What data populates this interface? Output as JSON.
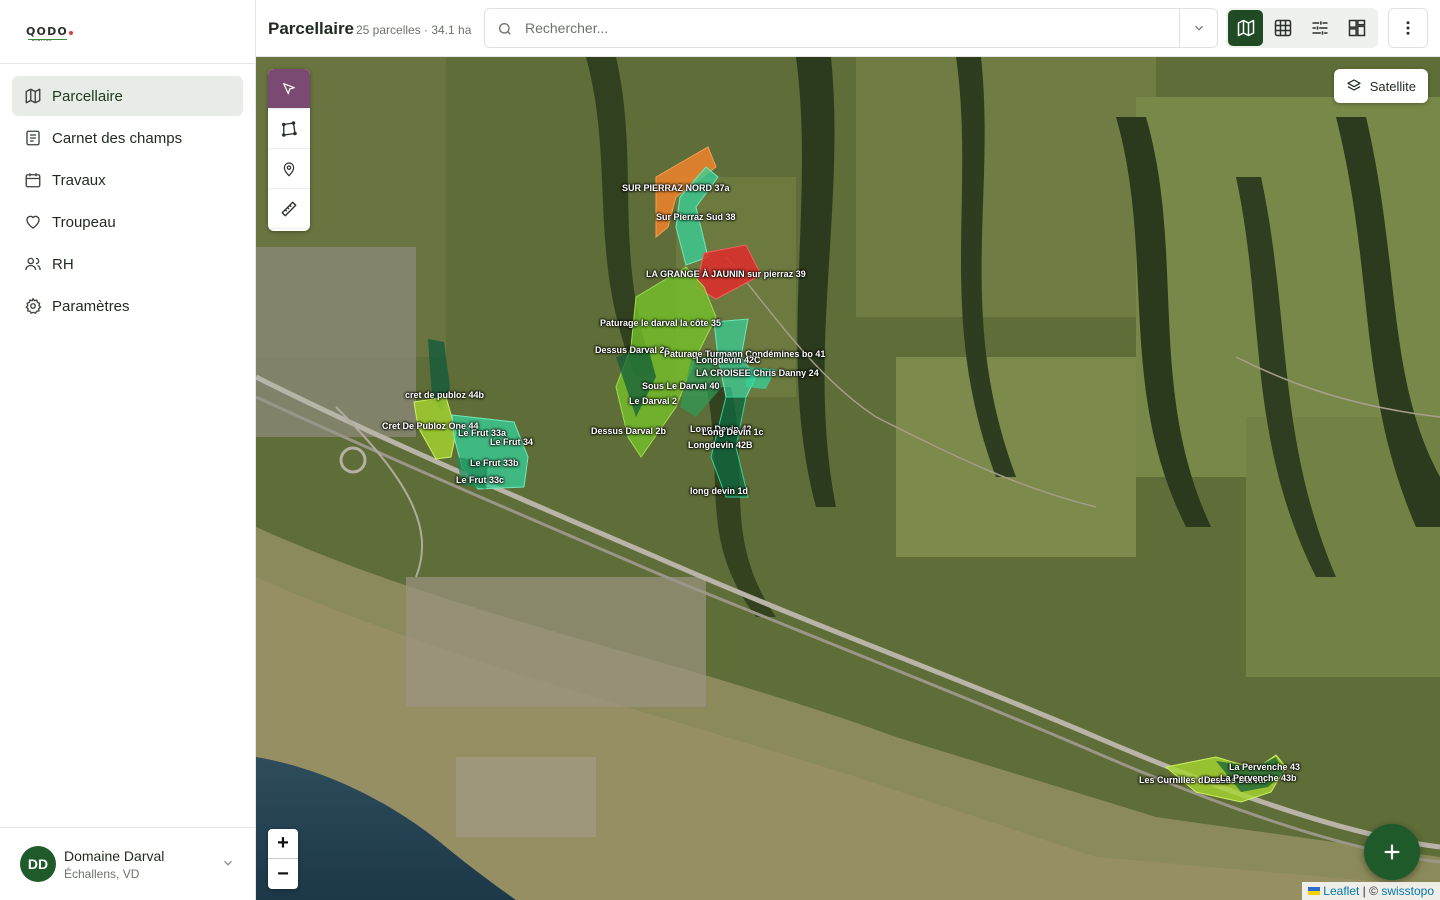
{
  "sidebar": {
    "logo": {
      "text": "QODO",
      "sub": "DIGITAL"
    },
    "items": [
      {
        "label": "Parcellaire",
        "icon": "map-icon",
        "active": true
      },
      {
        "label": "Carnet des champs",
        "icon": "notebook-icon",
        "active": false
      },
      {
        "label": "Travaux",
        "icon": "calendar-icon",
        "active": false
      },
      {
        "label": "Troupeau",
        "icon": "heart-icon",
        "active": false
      },
      {
        "label": "RH",
        "icon": "users-icon",
        "active": false
      },
      {
        "label": "Paramètres",
        "icon": "gear-icon",
        "active": false
      }
    ],
    "account": {
      "initials": "DD",
      "name": "Domaine Darval",
      "location": "Échallens, VD"
    }
  },
  "header": {
    "title": "Parcellaire",
    "subtitle": "25 parcelles · 34.1 ha",
    "search_placeholder": "Rechercher...",
    "views": [
      "map-view",
      "table-view",
      "filter-view",
      "dashboard-view"
    ],
    "active_view": "map-view"
  },
  "map": {
    "layer_label": "Satellite",
    "zoom_in": "+",
    "zoom_out": "−",
    "attribution": {
      "leaflet": "Leaflet",
      "separator": "| ©",
      "provider": "swisstopo"
    },
    "tools": [
      "select-tool",
      "polygon-tool",
      "marker-tool",
      "measure-tool"
    ],
    "parcels": [
      "SUR PIERRAZ NORD 37a",
      "Sur Pierraz Sud 38",
      "LA GRANGE À JAUNIN sur pierraz 39",
      "Paturage le darval la côte 35",
      "Dessus Darval 2c",
      "Paturage Turmann Condémines bo 41",
      "Longdevin 42C",
      "LA CROISEE Chris Danny 24",
      "Sous Le Darval 40",
      "Le Darval 2",
      "cret de publoz 44b",
      "Cret De Publoz One 44",
      "Le Frut 33a",
      "Le Frut 34",
      "Dessus Darval 2b",
      "Long Devin 42",
      "Long Devin 1c",
      "Longdevin 42B",
      "Le Frut 33b",
      "Le Frut 33c",
      "long devin 1d",
      "La Pervenche 43",
      "Les Curnilles dessus",
      "Dessus Darval",
      "La Pervenche 43b"
    ],
    "colors": {
      "orange": "#f0842a",
      "red": "#e02a2a",
      "teal": "#35d29a",
      "lime": "#a6d630",
      "green": "#4aa02a",
      "dark": "#0e5a3a"
    }
  }
}
